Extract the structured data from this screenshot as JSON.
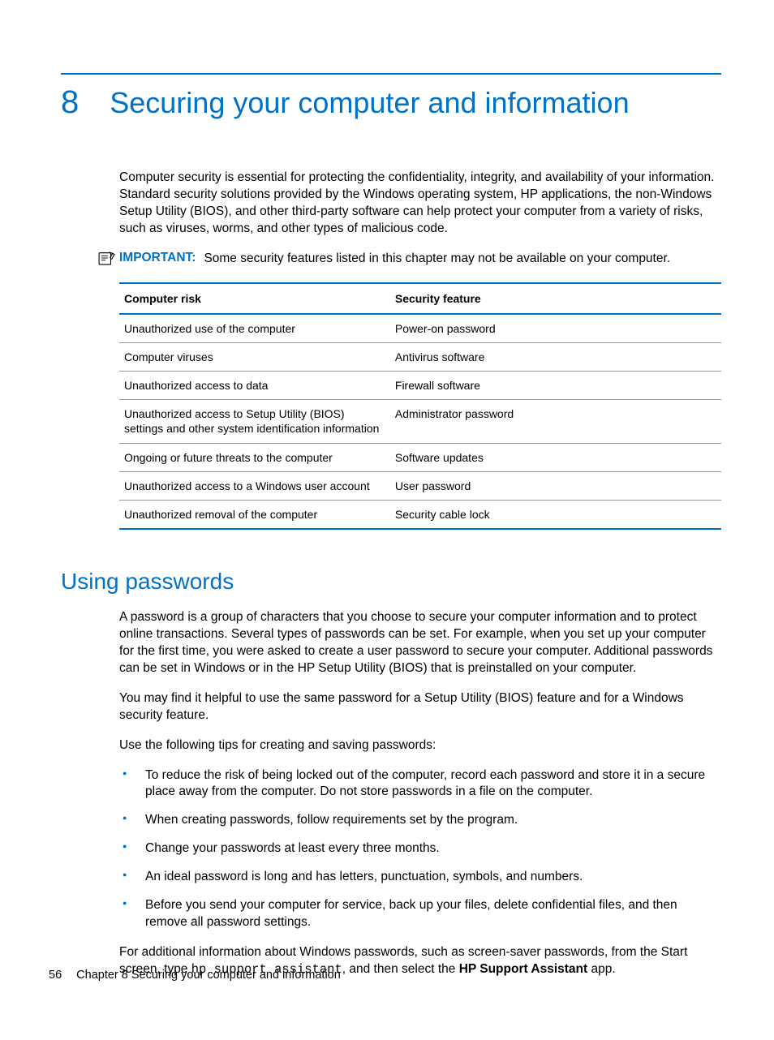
{
  "chapter": {
    "number": "8",
    "title": "Securing your computer and information"
  },
  "intro": "Computer security is essential for protecting the confidentiality, integrity, and availability of your information. Standard security solutions provided by the Windows operating system, HP applications, the non-Windows Setup Utility (BIOS), and other third-party software can help protect your computer from a variety of risks, such as viruses, worms, and other types of malicious code.",
  "important": {
    "label": "IMPORTANT:",
    "text": "Some security features listed in this chapter may not be available on your computer."
  },
  "table": {
    "headers": {
      "col1": "Computer risk",
      "col2": "Security feature"
    },
    "rows": [
      {
        "risk": "Unauthorized use of the computer",
        "feature": "Power-on password"
      },
      {
        "risk": "Computer viruses",
        "feature": "Antivirus software"
      },
      {
        "risk": "Unauthorized access to data",
        "feature": "Firewall software"
      },
      {
        "risk": "Unauthorized access to Setup Utility (BIOS) settings and other system identification information",
        "feature": "Administrator password"
      },
      {
        "risk": "Ongoing or future threats to the computer",
        "feature": "Software updates"
      },
      {
        "risk": "Unauthorized access to a Windows user account",
        "feature": "User password"
      },
      {
        "risk": "Unauthorized removal of the computer",
        "feature": "Security cable lock"
      }
    ]
  },
  "section": {
    "heading": "Using passwords",
    "p1": "A password is a group of characters that you choose to secure your computer information and to protect online transactions. Several types of passwords can be set. For example, when you set up your computer for the first time, you were asked to create a user password to secure your computer. Additional passwords can be set in Windows or in the HP Setup Utility (BIOS) that is preinstalled on your computer.",
    "p2": "You may find it helpful to use the same password for a Setup Utility (BIOS) feature and for a Windows security feature.",
    "p3": "Use the following tips for creating and saving passwords:",
    "bullets": [
      "To reduce the risk of being locked out of the computer, record each password and store it in a secure place away from the computer. Do not store passwords in a file on the computer.",
      "When creating passwords, follow requirements set by the program.",
      "Change your passwords at least every three months.",
      "An ideal password is long and has letters, punctuation, symbols, and numbers.",
      "Before you send your computer for service, back up your files, delete confidential files, and then remove all password settings."
    ],
    "p4_pre": "For additional information about Windows passwords, such as screen-saver passwords, from the Start screen, type ",
    "p4_code": "hp support assistant",
    "p4_mid": ", and then select the ",
    "p4_bold": "HP Support Assistant",
    "p4_post": " app."
  },
  "footer": {
    "page": "56",
    "text": "Chapter 8   Securing your computer and information"
  }
}
